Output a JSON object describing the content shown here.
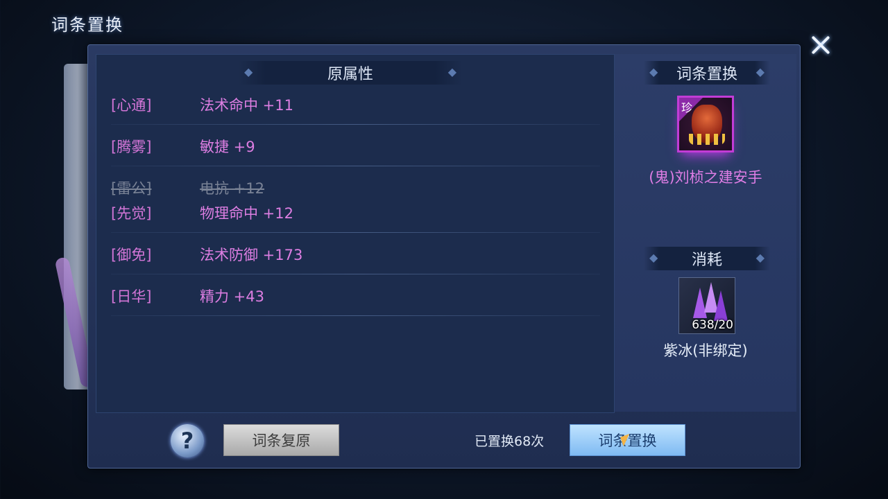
{
  "window": {
    "title": "词条置换"
  },
  "left_panel": {
    "header": "原属性",
    "attributes": [
      {
        "name": "[心通]",
        "value": "法术命中 +11",
        "struck": false
      },
      {
        "name": "[腾雾]",
        "value": "敏捷 +9",
        "struck": false
      },
      {
        "name": "[雷公]",
        "value": "电抗 +12",
        "struck": true
      },
      {
        "name": "[先觉]",
        "value": "物理命中 +12",
        "struck": false
      },
      {
        "name": "[御免]",
        "value": "法术防御 +173",
        "struck": false
      },
      {
        "name": "[日华]",
        "value": "精力 +43",
        "struck": false
      }
    ]
  },
  "right_panel": {
    "header": "词条置换",
    "item": {
      "tag": "珍",
      "name": "(鬼)刘桢之建安手",
      "icon": "claw-gauntlet-icon"
    },
    "cost_header": "消耗",
    "material": {
      "count": "638/20",
      "name": "紫冰(非绑定)",
      "icon": "purple-crystal-icon"
    }
  },
  "footer": {
    "help": "?",
    "restore_label": "词条复原",
    "count_text": "已置换68次",
    "replace_label": "词条置换"
  },
  "colors": {
    "attr": "#dd7ee2",
    "panel": "#1c2c4d",
    "accent": "#c23cd6"
  }
}
